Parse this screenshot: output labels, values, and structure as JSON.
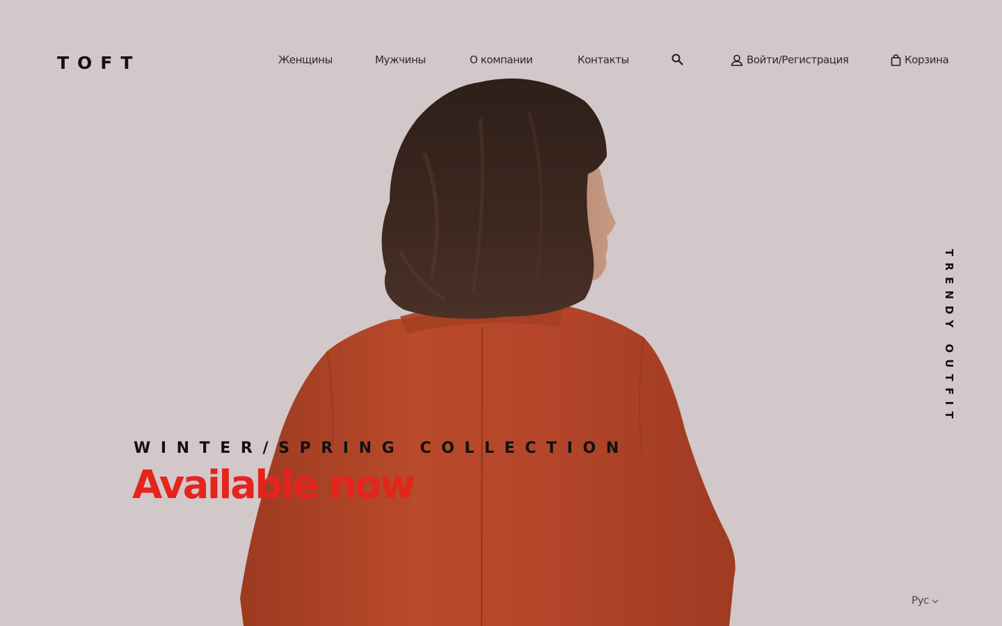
{
  "header": {
    "logo": "TOFT",
    "nav": {
      "women": "Женщины",
      "men": "Мужчины",
      "about": "О компании",
      "contacts": "Контакты",
      "login": "Войти/Регистрация",
      "cart": "Корзина"
    },
    "icons": {
      "search": "search-icon",
      "user": "user-icon",
      "cart": "shopping-bag-icon"
    }
  },
  "hero": {
    "collection": "WINTER/SPRING COLLECTION",
    "headline": "Available now",
    "side_text": "TRENDY OUTFIT"
  },
  "footer": {
    "language": "Рус"
  },
  "colors": {
    "background": "#d2c7c9",
    "accent": "#e5241c",
    "text": "#111111",
    "jacket": "#b34527",
    "hair": "#3a2620"
  }
}
